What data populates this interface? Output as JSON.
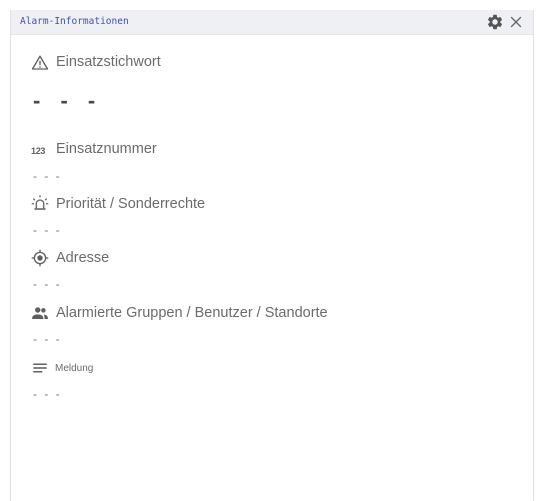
{
  "widget": {
    "title": "Alarm-Informationen"
  },
  "fields": {
    "keyword": {
      "label": "Einsatzstichwort",
      "value": "- - -"
    },
    "number": {
      "icon_text": "123",
      "label": "Einsatznummer",
      "value": "- - -"
    },
    "priority": {
      "label": "Priorität / Sonderrechte",
      "value": "- - -"
    },
    "address": {
      "label": "Adresse",
      "value": "- - -"
    },
    "groups": {
      "label": "Alarmierte Gruppen / Benutzer / Standorte",
      "value": "- - -"
    },
    "message": {
      "label": "Meldung",
      "value": "- - -"
    }
  },
  "icons": {
    "settings": "gear-icon",
    "close": "close-icon",
    "keyword": "warning-icon",
    "number": "numbers-icon",
    "priority": "siren-icon",
    "address": "location-target-icon",
    "groups": "people-icon",
    "message": "notes-icon"
  },
  "colors": {
    "title": "#3f51b5",
    "header_bg": "#eef0f3",
    "text": "#6b6b6b"
  }
}
